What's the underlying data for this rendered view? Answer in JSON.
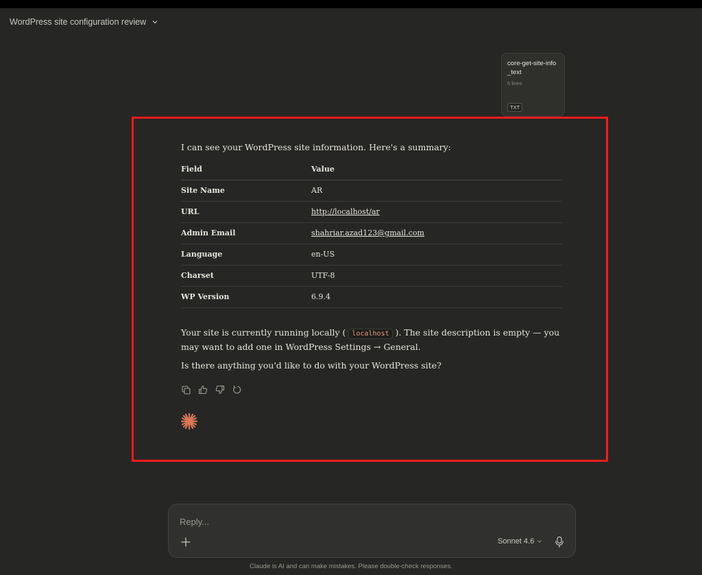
{
  "header": {
    "title": "WordPress site configuration review"
  },
  "attachment": {
    "name": "core-get-site-info_text",
    "lines": "5 lines",
    "type": "TXT"
  },
  "message": {
    "intro": "I can see your WordPress site information. Here's a summary:",
    "table": {
      "headers": [
        "Field",
        "Value"
      ],
      "rows": [
        {
          "field": "Site Name",
          "value": "AR"
        },
        {
          "field": "URL",
          "value": "http://localhost/ar"
        },
        {
          "field": "Admin Email",
          "value": "shahriar.azad123@gmail.com"
        },
        {
          "field": "Language",
          "value": "en-US"
        },
        {
          "field": "Charset",
          "value": "UTF-8"
        },
        {
          "field": "WP Version",
          "value": "6.9.4"
        }
      ]
    },
    "para1_before": "Your site is currently running locally (",
    "para1_code": "localhost",
    "para1_after": "). The site description is empty — you may want to add one in WordPress Settings → General.",
    "para2": "Is there anything you'd like to do with your WordPress site?"
  },
  "composer": {
    "placeholder": "Reply...",
    "model": "Sonnet 4.6"
  },
  "disclaimer": "Claude is AI and can make mistakes. Please double-check responses.",
  "colors": {
    "background": "#262624",
    "accent": "#d97757",
    "highlight": "#ff1a1a"
  },
  "icons": [
    "chevron-down-icon",
    "copy-icon",
    "thumbs-up-icon",
    "thumbs-down-icon",
    "retry-icon",
    "claude-spark-icon",
    "plus-icon",
    "mic-icon"
  ]
}
